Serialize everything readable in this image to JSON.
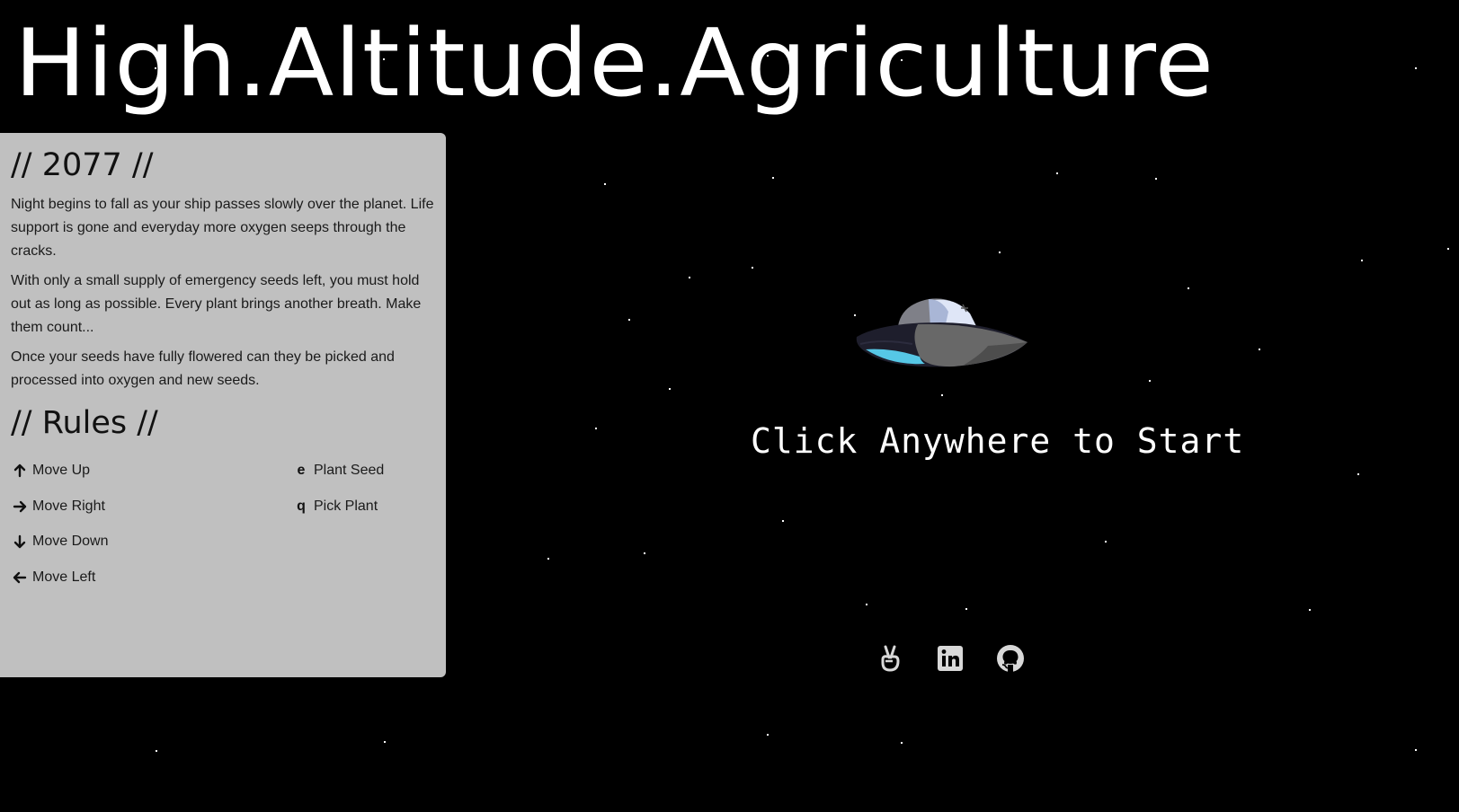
{
  "app": {
    "title": "High.Altitude.Agriculture"
  },
  "intro": {
    "heading": "// 2077 //",
    "paragraphs": [
      "Night begins to fall as your ship passes slowly over the planet. Life support is gone and everyday more oxygen seeps through the cracks.",
      "With only a small supply of emergency seeds left, you must hold out as long as possible. Every plant brings another breath. Make them count...",
      "Once your seeds have fully flowered can they be picked and processed into oxygen and new seeds."
    ]
  },
  "rules": {
    "heading": "// Rules //",
    "movement": [
      {
        "icon": "arrow-up-icon",
        "label": "Move Up"
      },
      {
        "icon": "arrow-right-icon",
        "label": "Move Right"
      },
      {
        "icon": "arrow-down-icon",
        "label": "Move Down"
      },
      {
        "icon": "arrow-left-icon",
        "label": "Move Left"
      }
    ],
    "actions": [
      {
        "key": "e",
        "label": "Plant Seed"
      },
      {
        "key": "q",
        "label": "Pick Plant"
      }
    ]
  },
  "game": {
    "start_prompt": "Click Anywhere to Start",
    "ship_icon": "spaceship-icon"
  },
  "social_links": [
    {
      "icon": "angellist-icon"
    },
    {
      "icon": "linkedin-icon"
    },
    {
      "icon": "github-icon"
    }
  ],
  "colors": {
    "background": "#000000",
    "panel": "#c0c0c0",
    "text_light": "#ffffff",
    "text_dark": "#111111",
    "ship_cyan": "#56c7e6"
  }
}
